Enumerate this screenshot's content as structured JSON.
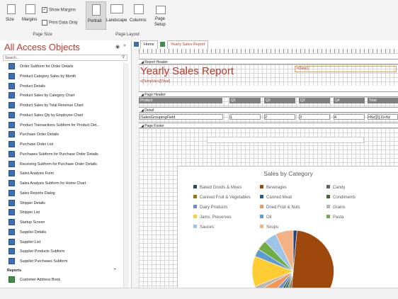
{
  "ribbon": {
    "size_label": "Size",
    "margins_label": "Margins",
    "show_margins": "Show Margins",
    "print_data_only": "Print Data Only",
    "page_size_group": "Page Size",
    "portrait": "Portrait",
    "landscape": "Landscape",
    "columns": "Columns",
    "page_setup_line1": "Page",
    "page_setup_line2": "Setup",
    "page_layout_group": "Page Layout"
  },
  "nav": {
    "title": "All Access Objects",
    "search_placeholder": "Search...",
    "items": [
      {
        "label": "Order Subform for Order Details",
        "icon": "form-icon"
      },
      {
        "label": "Product Category Sales by Month",
        "icon": "form-icon"
      },
      {
        "label": "Product Details",
        "icon": "form-icon"
      },
      {
        "label": "Product Sales by Category Chart",
        "icon": "form-icon"
      },
      {
        "label": "Product Sales by Total Revenue Chart",
        "icon": "form-icon"
      },
      {
        "label": "Product Sales Qty by Employee Chart",
        "icon": "form-icon"
      },
      {
        "label": "Product Transactions Subform for Product Det...",
        "icon": "form-icon"
      },
      {
        "label": "Purchase Order Details",
        "icon": "form-icon"
      },
      {
        "label": "Purchase Order List",
        "icon": "form-icon"
      },
      {
        "label": "Purchases Subform for Purchase Order Details",
        "icon": "form-icon"
      },
      {
        "label": "Receiving Subform for Purchase Order Details",
        "icon": "form-icon"
      },
      {
        "label": "Sales Analysis Form",
        "icon": "form-icon"
      },
      {
        "label": "Sales Analysis Subform for Home Chart",
        "icon": "form-icon"
      },
      {
        "label": "Sales Reports Dialog",
        "icon": "form-icon"
      },
      {
        "label": "Shipper Details",
        "icon": "form-icon"
      },
      {
        "label": "Shipper List",
        "icon": "form-icon"
      },
      {
        "label": "Startup Screen",
        "icon": "form-icon"
      },
      {
        "label": "Supplier Details",
        "icon": "form-icon"
      },
      {
        "label": "Supplier List",
        "icon": "form-icon"
      },
      {
        "label": "Supplier Products Subform",
        "icon": "form-icon"
      },
      {
        "label": "Supplier Purchases Subform",
        "icon": "form-icon"
      }
    ],
    "reports_header": "Reports",
    "reports_items": [
      {
        "label": "Customer Address Book",
        "icon": "report-icon"
      }
    ]
  },
  "tabs": [
    {
      "label": "Home",
      "icon": "form-icon"
    },
    {
      "label": "Yearly Sales Report",
      "icon": "report-icon"
    }
  ],
  "report": {
    "report_header": "Report Header",
    "title": "Yearly Sales Report",
    "date_field": "=Date()",
    "year_field": "=[TempVars]![Year]",
    "page_header": "Page Header",
    "col_product": "Product",
    "col_q1": "Q1",
    "col_q2": "Q2",
    "col_q3": "Q3",
    "col_q4": "Q4",
    "col_total": "Total",
    "detail": "Detail",
    "detail_field": "SalesGroupingField",
    "detail_v1": "1",
    "detail_v2": "2",
    "detail_v3": "3",
    "detail_v4": "4",
    "detail_total": "=Nz([1],0)+Nz",
    "page_footer": "Page Footer"
  },
  "chart_data": {
    "type": "pie",
    "title": "Sales by Category",
    "legend_position": "top",
    "categories": [
      {
        "name": "Baked Goods & Mixes",
        "color": "#264478"
      },
      {
        "name": "Beverages",
        "color": "#9e480e"
      },
      {
        "name": "Candy",
        "color": "#636363"
      },
      {
        "name": "Canned Fruit & Vegetables",
        "color": "#997300"
      },
      {
        "name": "Canned Meat",
        "color": "#255e91"
      },
      {
        "name": "Condiments",
        "color": "#43682b"
      },
      {
        "name": "Dairy Products",
        "color": "#698ed0"
      },
      {
        "name": "Dried Fruit & Nuts",
        "color": "#f1975a"
      },
      {
        "name": "Grains",
        "color": "#b7b7b7"
      },
      {
        "name": "Jams, Preserves",
        "color": "#ffcd33"
      },
      {
        "name": "Oil",
        "color": "#5b9bd5"
      },
      {
        "name": "Pasta",
        "color": "#70ad47"
      },
      {
        "name": "Sauces",
        "color": "#9dc3e6"
      },
      {
        "name": "Soups",
        "color": "#f4b183"
      }
    ],
    "slices": [
      {
        "name": "Baked Goods & Mixes",
        "value": 1.5,
        "color": "#264478"
      },
      {
        "name": "Beverages",
        "value": 50,
        "color": "#9e480e"
      },
      {
        "name": "Candy",
        "value": 2,
        "color": "#636363"
      },
      {
        "name": "Canned Fruit & Vegetables",
        "value": 1.5,
        "color": "#997300"
      },
      {
        "name": "Canned Meat",
        "value": 2,
        "color": "#255e91"
      },
      {
        "name": "Condiments",
        "value": 2,
        "color": "#43682b"
      },
      {
        "name": "Dairy Products",
        "value": 3,
        "color": "#698ed0"
      },
      {
        "name": "Dried Fruit & Nuts",
        "value": 5,
        "color": "#f1975a"
      },
      {
        "name": "Grains",
        "value": 2,
        "color": "#b7b7b7"
      },
      {
        "name": "Jams, Preserves",
        "value": 12,
        "color": "#ffcd33"
      },
      {
        "name": "Oil",
        "value": 3,
        "color": "#5b9bd5"
      },
      {
        "name": "Pasta",
        "value": 4,
        "color": "#70ad47"
      },
      {
        "name": "Sauces",
        "value": 5,
        "color": "#9dc3e6"
      },
      {
        "name": "Soups",
        "value": 7,
        "color": "#f4b183"
      }
    ]
  }
}
